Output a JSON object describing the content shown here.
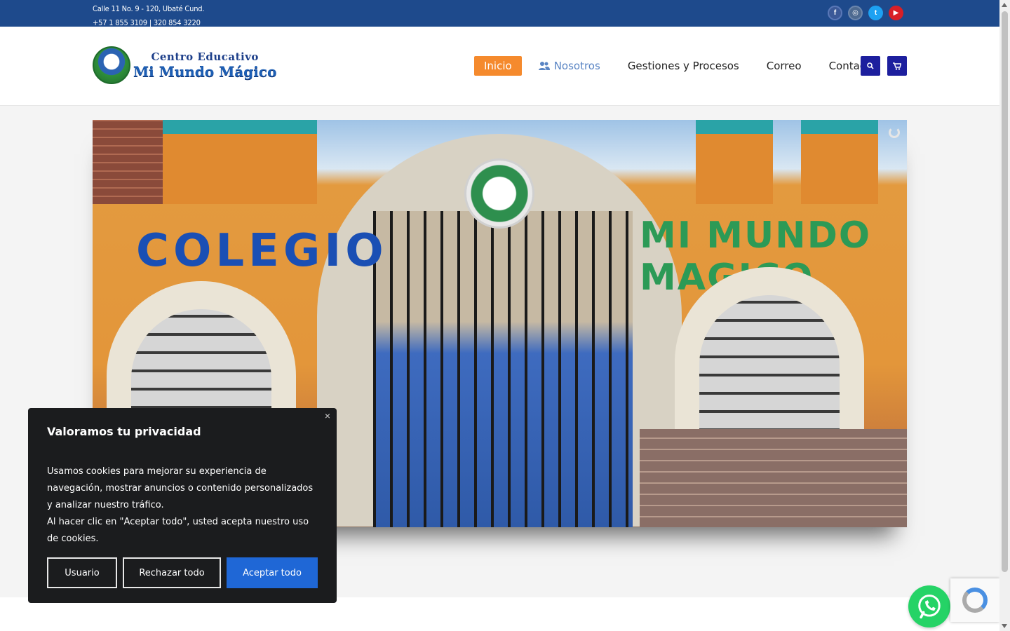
{
  "topbar": {
    "address": "Calle 11 No. 9 - 120, Ubaté Cund.",
    "phone": "+57 1 855 3109 | 320 854 3220",
    "social": [
      "facebook-icon",
      "instagram-icon",
      "twitter-icon",
      "youtube-icon"
    ]
  },
  "logo": {
    "top_text": "Centro Educativo",
    "main_text": "Mi Mundo Mágico"
  },
  "nav": {
    "items": [
      "Inicio",
      "Nosotros",
      "Gestiones y Procesos",
      "Correo",
      "Contacto"
    ]
  },
  "hero": {
    "sign_left": "COLEGIO",
    "sign_right": "MI MUNDO MAGICO"
  },
  "cookie": {
    "title": "Valoramos tu privacidad",
    "body": "Usamos cookies para mejorar su experiencia de navegación, mostrar anuncios o contenido personalizados y analizar nuestro tráfico.",
    "body2": "Al hacer clic en \"Aceptar todo\", usted acepta nuestro uso de cookies.",
    "btn_user": "Usuario",
    "btn_reject": "Rechazar todo",
    "btn_accept": "Aceptar todo",
    "close": "×"
  },
  "colors": {
    "topbar": "#1e4a8c",
    "accent": "#f58a2d",
    "nav_active": "#5a85c4",
    "icon_button": "#1d1f9e",
    "accept": "#1f67d6",
    "whatsapp": "#25d366"
  }
}
